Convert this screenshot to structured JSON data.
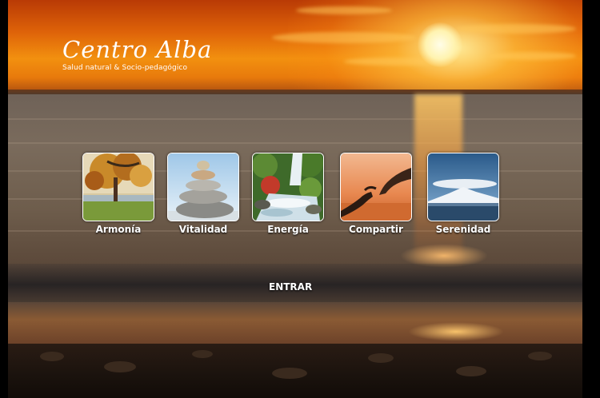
{
  "brand": {
    "title": "Centro Alba",
    "subtitle": "Salud natural & Socio-pedagógico"
  },
  "menu": {
    "items": [
      {
        "label": "Armonía",
        "icon": "autumn-tree-icon"
      },
      {
        "label": "Vitalidad",
        "icon": "stacked-stones-icon"
      },
      {
        "label": "Energía",
        "icon": "waterfall-icon"
      },
      {
        "label": "Compartir",
        "icon": "touching-hands-icon"
      },
      {
        "label": "Serenidad",
        "icon": "snowy-mountain-icon"
      }
    ]
  },
  "enter": {
    "label": "ENTRAR"
  },
  "colors": {
    "background": "#000000",
    "text": "#ffffff",
    "sky": "#e87a0c",
    "sea": "#6e5d4c"
  }
}
